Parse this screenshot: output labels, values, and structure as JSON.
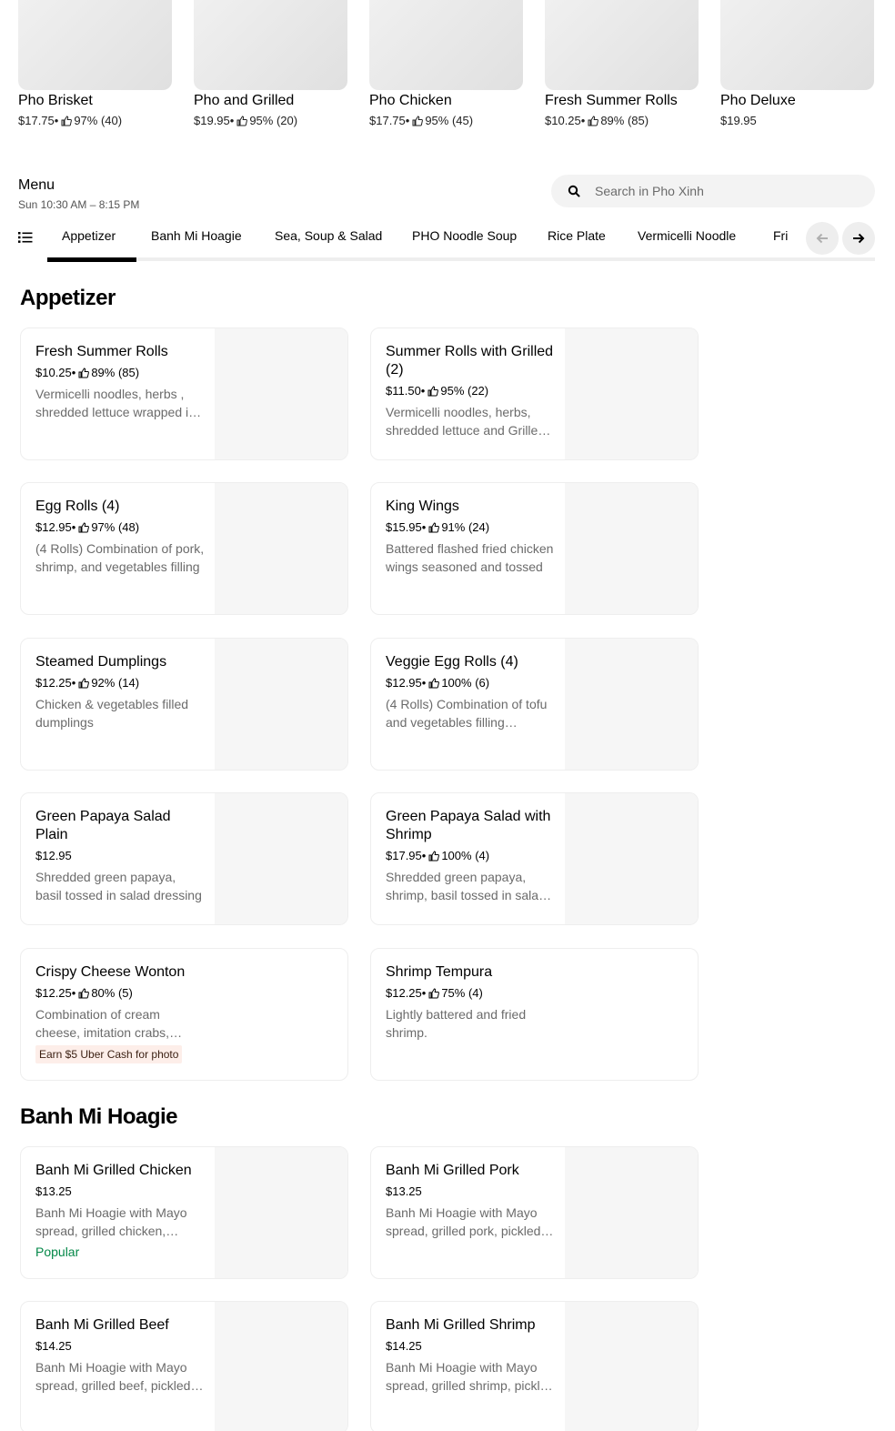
{
  "featured": [
    {
      "name": "Pho Brisket",
      "price": "$17.75",
      "rating": "97% (40)"
    },
    {
      "name": "Pho and Grilled",
      "price": "$19.95",
      "rating": "95% (20)"
    },
    {
      "name": "Pho Chicken",
      "price": "$17.75",
      "rating": "95% (45)"
    },
    {
      "name": "Fresh Summer Rolls",
      "price": "$10.25",
      "rating": "89% (85)"
    },
    {
      "name": "Pho Deluxe",
      "price": "$19.95",
      "rating": ""
    }
  ],
  "menu": {
    "title": "Menu",
    "hours": "Sun 10:30 AM – 8:15 PM",
    "search_placeholder": "Search in Pho Xinh"
  },
  "tabs": [
    {
      "label": "Appetizer",
      "active": true
    },
    {
      "label": "Banh Mi Hoagie"
    },
    {
      "label": "Sea, Soup & Salad"
    },
    {
      "label": "PHO Noodle Soup"
    },
    {
      "label": "Rice Plate"
    },
    {
      "label": "Vermicelli Noodle"
    },
    {
      "label": "Fri"
    }
  ],
  "meta_separator": " • ",
  "sections": [
    {
      "title": "Appetizer",
      "items": [
        {
          "name": "Fresh Summer Rolls",
          "price": "$10.25",
          "rating": "89% (85)",
          "description": "Vermicelli noodles, herbs , shredded lettuce wrapped in rice paper"
        },
        {
          "name": "Summer Rolls with Grilled (2)",
          "price": "$11.50",
          "rating": "95% (22)",
          "description": "Vermicelli noodles, herbs, shredded lettuce and Grilled meat wrapped in rice paper"
        },
        {
          "name": "Egg Rolls (4)",
          "price": "$12.95",
          "rating": "97% (48)",
          "description": "(4 Rolls) Combination of pork, shrimp, and vegetables filling"
        },
        {
          "name": "King Wings",
          "price": "$15.95",
          "rating": "91% (24)",
          "description": "Battered flashed fried chicken wings seasoned and tossed"
        },
        {
          "name": "Steamed Dumplings",
          "price": "$12.25",
          "rating": "92% (14)",
          "description": "Chicken & vegetables filled dumplings"
        },
        {
          "name": "Veggie Egg Rolls (4)",
          "price": "$12.95",
          "rating": "100% (6)",
          "description": "(4 Rolls) Combination of tofu and vegetables filling wrapped"
        },
        {
          "name": "Green Papaya Salad Plain",
          "price": "$12.95",
          "rating": "",
          "description": "Shredded green papaya, basil tossed in salad dressing"
        },
        {
          "name": "Green Papaya Salad with Shrimp",
          "price": "$17.95",
          "rating": "100% (4)",
          "description": "Shredded green papaya, shrimp, basil tossed in salad dressing"
        },
        {
          "name": "Crispy Cheese Wonton",
          "price": "$12.25",
          "rating": "80% (5)",
          "description": "Combination of cream cheese, imitation crabs, scallions",
          "badge": "Earn $5 Uber Cash for photo"
        },
        {
          "name": "Shrimp Tempura",
          "price": "$12.25",
          "rating": "75% (4)",
          "description": "Lightly battered and fried shrimp."
        }
      ]
    },
    {
      "title": "Banh Mi Hoagie",
      "items": [
        {
          "name": "Banh Mi Grilled Chicken",
          "price": "$13.25",
          "rating": "",
          "description": "Banh Mi Hoagie with Mayo spread, grilled chicken, pickled carrots",
          "tag": "Popular"
        },
        {
          "name": "Banh Mi Grilled Pork",
          "price": "$13.25",
          "rating": "",
          "description": "Banh Mi Hoagie with Mayo spread, grilled pork, pickled carrots"
        },
        {
          "name": "Banh Mi Grilled Beef",
          "price": "$14.25",
          "rating": "",
          "description": "Banh Mi Hoagie with Mayo spread, grilled beef, pickled carrots"
        },
        {
          "name": "Banh Mi Grilled Shrimp",
          "price": "$14.25",
          "rating": "",
          "description": "Banh Mi Hoagie with Mayo spread, grilled shrimp, pickled carrots"
        }
      ]
    }
  ]
}
